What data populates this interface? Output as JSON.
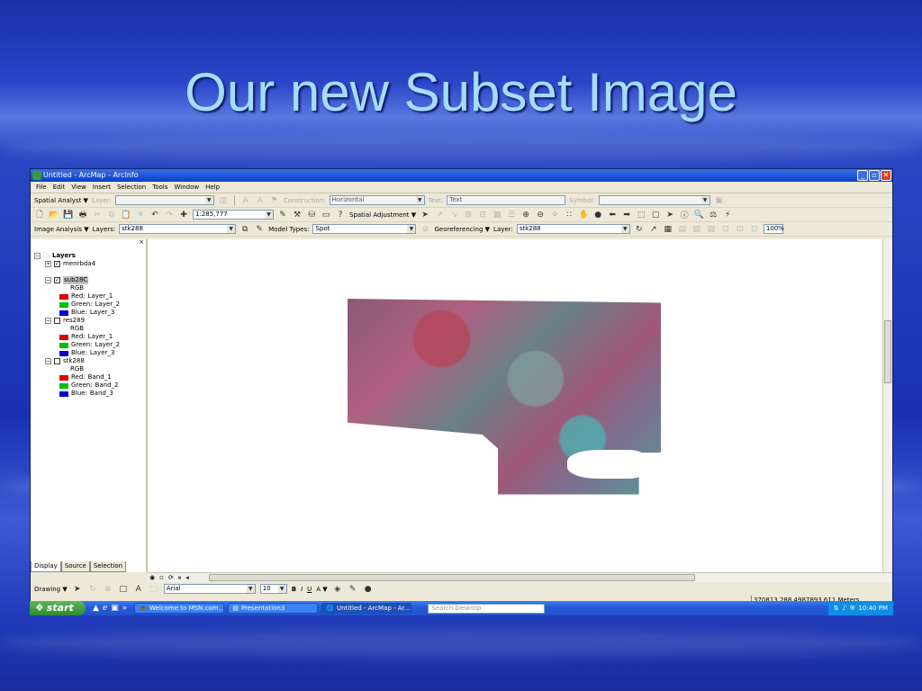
{
  "slide": {
    "title": "Our new Subset Image"
  },
  "window": {
    "title": "Untitled - ArcMap - ArcInfo",
    "controls": {
      "minimize": "_",
      "maximize": "▫",
      "close": "✕"
    }
  },
  "menu": [
    "File",
    "Edit",
    "View",
    "Insert",
    "Selection",
    "Tools",
    "Window",
    "Help"
  ],
  "toolbar1": {
    "spatial_analyst": "Spatial Analyst ▼",
    "layer_label": "Layer:",
    "construction_label": "Construction:",
    "construction_value": "Horizontal",
    "text_label": "Text:",
    "text_value": "Text",
    "symbol_label": "Symbol:"
  },
  "toolbar2": {
    "scale_value": "1:285,777",
    "spatial_adjustment": "Spatial Adjustment ▼"
  },
  "toolbar3": {
    "image_analysis": "Image Analysis ▼",
    "layers_label": "Layers:",
    "layers_value": "stk288",
    "model_types_label": "Model Types:",
    "model_types_value": "Spot",
    "georeferencing": "Georeferencing ▼",
    "layer_label": "Layer:",
    "layer_value": "stk288",
    "zoom_value": "100%"
  },
  "toc": {
    "close": "×",
    "root": "Layers",
    "layers": [
      {
        "name": "menrbda4",
        "checked": true,
        "expanded": false,
        "entries": []
      },
      {
        "name": "sub28C",
        "checked": true,
        "expanded": true,
        "rgb": "RGB",
        "entries": [
          {
            "channel": "Red:",
            "band": "Layer_1",
            "color": "#e00000"
          },
          {
            "channel": "Green:",
            "band": "Layer_2",
            "color": "#00c000"
          },
          {
            "channel": "Blue:",
            "band": "Layer_3",
            "color": "#0000d0"
          }
        ]
      },
      {
        "name": "res289",
        "checked": false,
        "expanded": true,
        "rgb": "RGB",
        "entries": [
          {
            "channel": "Red:",
            "band": "Layer_1",
            "color": "#e00000"
          },
          {
            "channel": "Green:",
            "band": "Layer_2",
            "color": "#00c000"
          },
          {
            "channel": "Blue:",
            "band": "Layer_3",
            "color": "#0000d0"
          }
        ]
      },
      {
        "name": "stk288",
        "checked": false,
        "expanded": true,
        "rgb": "RGB",
        "entries": [
          {
            "channel": "Red:",
            "band": "Band_1",
            "color": "#e00000"
          },
          {
            "channel": "Green:",
            "band": "Band_2",
            "color": "#00c000"
          },
          {
            "channel": "Blue:",
            "band": "Band_3",
            "color": "#0000d0"
          }
        ]
      }
    ],
    "tabs": [
      "Display",
      "Source",
      "Selection"
    ]
  },
  "draw": {
    "drawing": "Drawing ▼",
    "font": "Arial",
    "size": "10",
    "bold": "B",
    "italic": "I",
    "underline": "U",
    "font_color": "A ▼"
  },
  "status": {
    "coords": "370813.288  4987893.611 Meters"
  },
  "taskbar": {
    "start": "start",
    "tasks": [
      "Welcome to MSN.com...",
      "Presentation3",
      "Untitled - ArcMap - Ar..."
    ],
    "search": "Search Desktop",
    "clock": "10:40 PM"
  }
}
